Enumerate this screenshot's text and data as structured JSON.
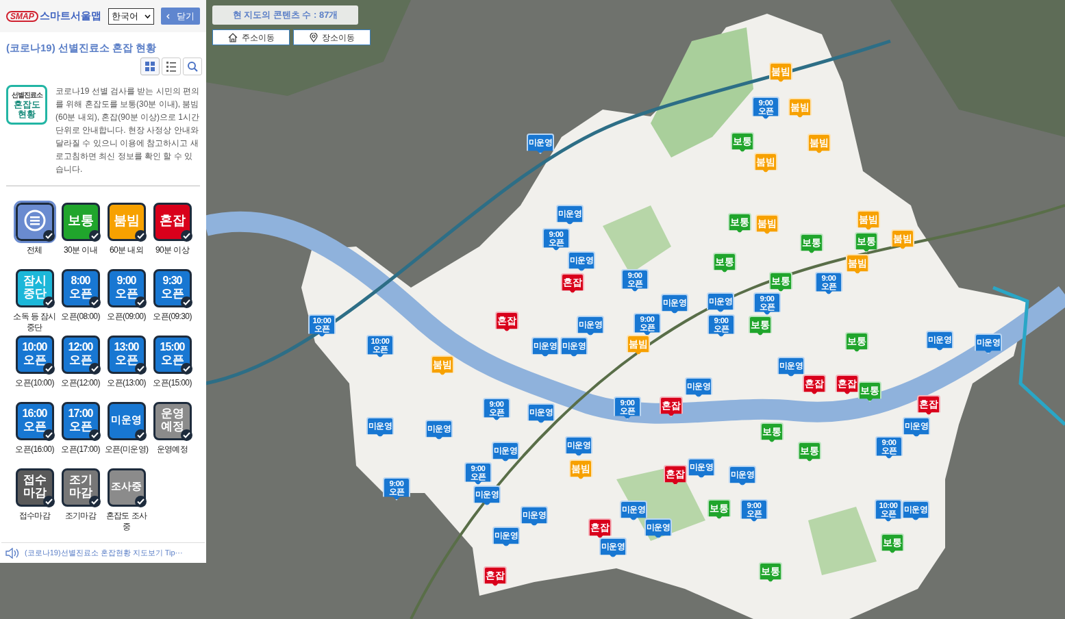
{
  "sidebar": {
    "logo": {
      "mark": "SMAP",
      "name": "스마트서울맵"
    },
    "language": {
      "value": "한국어"
    },
    "close_button": "닫기",
    "title": "(코로나19) 선별진료소 혼잡 현황",
    "view_buttons": [
      {
        "kind": "grid",
        "selected": true
      },
      {
        "kind": "list",
        "selected": false
      },
      {
        "kind": "search",
        "selected": false
      }
    ],
    "badge_lines": [
      "선별진료소",
      "혼잡도",
      "현황"
    ],
    "description": "코로나19 선별 검사를 받는 시민의 편의를 위해 혼잡도를 보통(30분 이내), 붐빔(60분 내외), 혼잡(90분 이상)으로 1시간 단위로 안내합니다. 현장 사정상 안내와 달라질 수 있으니 이용에 참고하시고 새로고침하면 최신 정보를 확인 할 수 있습니다.",
    "legend": [
      {
        "kind": "all",
        "label": "전체",
        "checked": true,
        "selected": true
      },
      {
        "kind": "normal",
        "lines": [
          "보통"
        ],
        "label": "30분 이내",
        "checked": true,
        "selected": false
      },
      {
        "kind": "busy",
        "lines": [
          "붐빔"
        ],
        "label": "60분 내외",
        "checked": true,
        "selected": false
      },
      {
        "kind": "crowded",
        "lines": [
          "혼잡"
        ],
        "label": "90분 이상",
        "checked": true,
        "selected": false
      },
      {
        "kind": "paused",
        "lines": [
          "잠시",
          "중단"
        ],
        "label": "소독 등 잠시중단",
        "checked": true,
        "selected": false
      },
      {
        "kind": "open",
        "lines": [
          "8:00",
          "오픈"
        ],
        "label": "오픈(08:00)",
        "checked": true,
        "selected": false
      },
      {
        "kind": "open",
        "lines": [
          "9:00",
          "오픈"
        ],
        "label": "오픈(09:00)",
        "checked": true,
        "selected": false
      },
      {
        "kind": "open",
        "lines": [
          "9:30",
          "오픈"
        ],
        "label": "오픈(09:30)",
        "checked": true,
        "selected": false
      },
      {
        "kind": "open",
        "lines": [
          "10:00",
          "오픈"
        ],
        "label": "오픈(10:00)",
        "checked": true,
        "selected": false
      },
      {
        "kind": "open",
        "lines": [
          "12:00",
          "오픈"
        ],
        "label": "오픈(12:00)",
        "checked": true,
        "selected": false
      },
      {
        "kind": "open",
        "lines": [
          "13:00",
          "오픈"
        ],
        "label": "오픈(13:00)",
        "checked": true,
        "selected": false
      },
      {
        "kind": "open",
        "lines": [
          "15:00",
          "오픈"
        ],
        "label": "오픈(15:00)",
        "checked": true,
        "selected": false
      },
      {
        "kind": "open",
        "lines": [
          "16:00",
          "오픈"
        ],
        "label": "오픈(16:00)",
        "checked": true,
        "selected": false
      },
      {
        "kind": "open",
        "lines": [
          "17:00",
          "오픈"
        ],
        "label": "오픈(17:00)",
        "checked": true,
        "selected": false
      },
      {
        "kind": "open",
        "lines": [
          "미운영"
        ],
        "label": "오픈(미운영)",
        "checked": true,
        "selected": false
      },
      {
        "kind": "scheduled",
        "lines": [
          "운영",
          "예정"
        ],
        "label": "운영예정",
        "checked": true,
        "selected": false
      },
      {
        "kind": "closed",
        "lines": [
          "접수",
          "마감"
        ],
        "label": "접수마감",
        "checked": true,
        "selected": false
      },
      {
        "kind": "early",
        "lines": [
          "조기",
          "마감"
        ],
        "label": "조기마감",
        "checked": true,
        "selected": false
      },
      {
        "kind": "scheduled",
        "lines": [
          "조사중"
        ],
        "label": "혼잡도 조사중",
        "checked": true,
        "selected": false
      }
    ],
    "tip_link": "(코로나19)선별진료소 혼잡현황 지도보기 Tip···"
  },
  "map": {
    "content_count": "현 지도의 콘텐츠 수 : 87개",
    "nav_buttons": [
      {
        "kind": "address",
        "label": "주소이동"
      },
      {
        "kind": "place",
        "label": "장소이동"
      }
    ],
    "markers": [
      {
        "kind": "busy",
        "lines": [
          "붐빔"
        ]
      },
      {
        "kind": "open",
        "lines": [
          "9:00",
          "오픈"
        ]
      },
      {
        "kind": "busy",
        "lines": [
          "붐빔"
        ]
      },
      {
        "kind": "open",
        "lines": [
          "미운영"
        ]
      },
      {
        "kind": "normal",
        "lines": [
          "보통"
        ]
      },
      {
        "kind": "busy",
        "lines": [
          "붐빔"
        ]
      },
      {
        "kind": "busy",
        "lines": [
          "붐빔"
        ]
      },
      {
        "kind": "open",
        "lines": [
          "미운영"
        ]
      },
      {
        "kind": "normal",
        "lines": [
          "보통"
        ]
      },
      {
        "kind": "busy",
        "lines": [
          "붐빔"
        ]
      },
      {
        "kind": "busy",
        "lines": [
          "붐빔"
        ]
      },
      {
        "kind": "open",
        "lines": [
          "9:00",
          "오픈"
        ]
      },
      {
        "kind": "normal",
        "lines": [
          "보통"
        ]
      },
      {
        "kind": "normal",
        "lines": [
          "보통"
        ]
      },
      {
        "kind": "busy",
        "lines": [
          "붐빔"
        ]
      },
      {
        "kind": "open",
        "lines": [
          "미운영"
        ]
      },
      {
        "kind": "normal",
        "lines": [
          "보통"
        ]
      },
      {
        "kind": "busy",
        "lines": [
          "붐빔"
        ]
      },
      {
        "kind": "crowded",
        "lines": [
          "혼잡"
        ]
      },
      {
        "kind": "open",
        "lines": [
          "9:00",
          "오픈"
        ]
      },
      {
        "kind": "normal",
        "lines": [
          "보통"
        ]
      },
      {
        "kind": "open",
        "lines": [
          "9:00",
          "오픈"
        ]
      },
      {
        "kind": "open",
        "lines": [
          "미운영"
        ]
      },
      {
        "kind": "open",
        "lines": [
          "미운영"
        ]
      },
      {
        "kind": "open",
        "lines": [
          "9:00",
          "오픈"
        ]
      },
      {
        "kind": "open",
        "lines": [
          "10:00",
          "오픈"
        ]
      },
      {
        "kind": "crowded",
        "lines": [
          "혼잡"
        ]
      },
      {
        "kind": "open",
        "lines": [
          "미운영"
        ]
      },
      {
        "kind": "open",
        "lines": [
          "9:00",
          "오픈"
        ]
      },
      {
        "kind": "open",
        "lines": [
          "9:00",
          "오픈"
        ]
      },
      {
        "kind": "normal",
        "lines": [
          "보통"
        ]
      },
      {
        "kind": "open",
        "lines": [
          "10:00",
          "오픈"
        ]
      },
      {
        "kind": "open",
        "lines": [
          "미운영"
        ]
      },
      {
        "kind": "open",
        "lines": [
          "미운영"
        ]
      },
      {
        "kind": "busy",
        "lines": [
          "붐빔"
        ]
      },
      {
        "kind": "normal",
        "lines": [
          "보통"
        ]
      },
      {
        "kind": "open",
        "lines": [
          "미운영"
        ]
      },
      {
        "kind": "open",
        "lines": [
          "미운영"
        ]
      },
      {
        "kind": "busy",
        "lines": [
          "붐빔"
        ]
      },
      {
        "kind": "open",
        "lines": [
          "미운영"
        ]
      },
      {
        "kind": "open",
        "lines": [
          "미운영"
        ]
      },
      {
        "kind": "crowded",
        "lines": [
          "혼잡"
        ]
      },
      {
        "kind": "crowded",
        "lines": [
          "혼잡"
        ]
      },
      {
        "kind": "normal",
        "lines": [
          "보통"
        ]
      },
      {
        "kind": "open",
        "lines": [
          "9:00",
          "오픈"
        ]
      },
      {
        "kind": "open",
        "lines": [
          "미운영"
        ]
      },
      {
        "kind": "open",
        "lines": [
          "9:00",
          "오픈"
        ]
      },
      {
        "kind": "crowded",
        "lines": [
          "혼잡"
        ]
      },
      {
        "kind": "crowded",
        "lines": [
          "혼잡"
        ]
      },
      {
        "kind": "open",
        "lines": [
          "미운영"
        ]
      },
      {
        "kind": "open",
        "lines": [
          "미운영"
        ]
      },
      {
        "kind": "normal",
        "lines": [
          "보통"
        ]
      },
      {
        "kind": "open",
        "lines": [
          "미운영"
        ]
      },
      {
        "kind": "open",
        "lines": [
          "미운영"
        ]
      },
      {
        "kind": "open",
        "lines": [
          "미운영"
        ]
      },
      {
        "kind": "normal",
        "lines": [
          "보통"
        ]
      },
      {
        "kind": "open",
        "lines": [
          "9:00",
          "오픈"
        ]
      },
      {
        "kind": "open",
        "lines": [
          "9:00",
          "오픈"
        ]
      },
      {
        "kind": "busy",
        "lines": [
          "붐빔"
        ]
      },
      {
        "kind": "crowded",
        "lines": [
          "혼잡"
        ]
      },
      {
        "kind": "open",
        "lines": [
          "미운영"
        ]
      },
      {
        "kind": "open",
        "lines": [
          "미운영"
        ]
      },
      {
        "kind": "open",
        "lines": [
          "9:00",
          "오픈"
        ]
      },
      {
        "kind": "open",
        "lines": [
          "미운영"
        ]
      },
      {
        "kind": "open",
        "lines": [
          "미운영"
        ]
      },
      {
        "kind": "open",
        "lines": [
          "미운영"
        ]
      },
      {
        "kind": "normal",
        "lines": [
          "보통"
        ]
      },
      {
        "kind": "open",
        "lines": [
          "9:00",
          "오픈"
        ]
      },
      {
        "kind": "open",
        "lines": [
          "10:00",
          "오픈"
        ]
      },
      {
        "kind": "open",
        "lines": [
          "미운영"
        ]
      },
      {
        "kind": "open",
        "lines": [
          "미운영"
        ]
      },
      {
        "kind": "crowded",
        "lines": [
          "혼잡"
        ]
      },
      {
        "kind": "open",
        "lines": [
          "미운영"
        ]
      },
      {
        "kind": "open",
        "lines": [
          "미운영"
        ]
      },
      {
        "kind": "normal",
        "lines": [
          "보통"
        ]
      },
      {
        "kind": "crowded",
        "lines": [
          "혼잡"
        ]
      },
      {
        "kind": "normal",
        "lines": [
          "보통"
        ]
      }
    ]
  }
}
